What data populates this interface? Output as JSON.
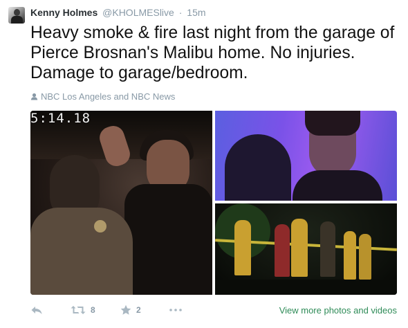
{
  "tweet": {
    "author_name": "Kenny Holmes",
    "username": "@KHOLMESlive",
    "separator": "·",
    "time": "15m",
    "text": "Heavy smoke & fire last night from the garage of Pierce Brosnan's Malibu home. No injuries. Damage to garage/bedroom.",
    "attribution": "NBC Los Angeles and NBC News"
  },
  "media": {
    "photo1_overlay": "5:14.18"
  },
  "actions": {
    "reply_icon": "reply-icon",
    "retweet_icon": "retweet-icon",
    "retweet_count": "8",
    "favorite_icon": "star-icon",
    "favorite_count": "2",
    "more_icon": "more-dots-icon",
    "view_more": "View more photos and videos"
  },
  "colors": {
    "text": "#292f33",
    "secondary": "#8899a6",
    "link_green": "#2e8b57"
  }
}
